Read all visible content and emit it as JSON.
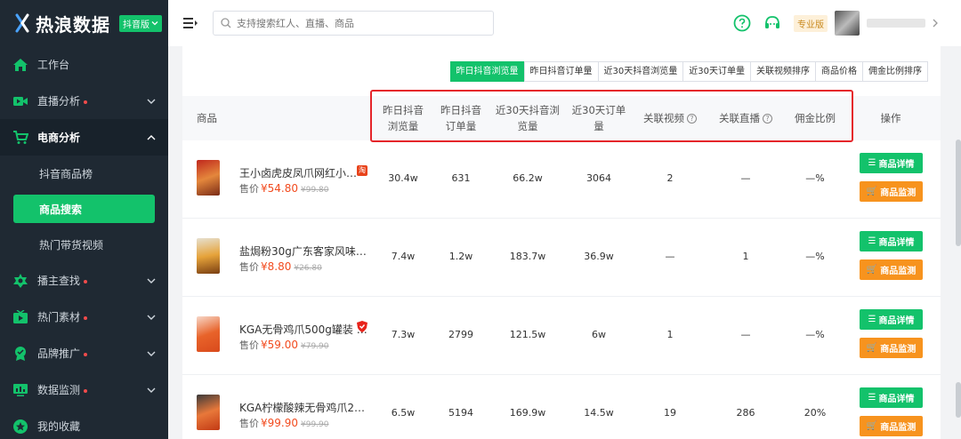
{
  "app": {
    "name": "热浪数据",
    "edition_badge": "抖音版"
  },
  "sidebar": {
    "items": [
      {
        "label": "工作台",
        "icon": "home-icon",
        "dot": false
      },
      {
        "label": "直播分析",
        "icon": "live-icon",
        "dot": true
      },
      {
        "label": "电商分析",
        "icon": "cart-icon",
        "dot": false,
        "open": true
      },
      {
        "label": "播主查找",
        "icon": "anchor-icon",
        "dot": true
      },
      {
        "label": "热门素材",
        "icon": "video-icon",
        "dot": true
      },
      {
        "label": "品牌推广",
        "icon": "brand-icon",
        "dot": true
      },
      {
        "label": "数据监测",
        "icon": "monitor-icon",
        "dot": true
      },
      {
        "label": "我的收藏",
        "icon": "favorite-icon",
        "dot": false
      }
    ],
    "submenu": [
      "抖音商品榜",
      "商品搜索",
      "热门带货视频"
    ],
    "active_sub": "商品搜索"
  },
  "topbar": {
    "search_placeholder": "支持搜索红人、直播、商品",
    "plan_badge": "专业版"
  },
  "tabs": [
    "昨日抖音浏览量",
    "昨日抖音订单量",
    "近30天抖音浏览量",
    "近30天订单量",
    "关联视频排序",
    "商品价格",
    "佣金比例排序"
  ],
  "active_tab": "昨日抖音浏览量",
  "table": {
    "headers": {
      "product": "商品",
      "yday_views_1": "昨日抖音",
      "yday_views_2": "浏览量",
      "yday_orders_1": "昨日抖音",
      "yday_orders_2": "订单量",
      "d30_views_1": "近30天抖音浏",
      "d30_views_2": "览量",
      "d30_orders_1": "近30天订单",
      "d30_orders_2": "量",
      "videos": "关联视频",
      "lives": "关联直播",
      "commission": "佣金比例",
      "actions": "操作"
    },
    "price_label": "售价",
    "detail_button": "商品详情",
    "monitor_button": "商品监测",
    "rows": [
      {
        "name": "王小卤虎皮凤爪网红小…",
        "price": "¥54.80",
        "old_price": "¥99.80",
        "yday_views": "30.4w",
        "yday_orders": "631",
        "d30_views": "66.2w",
        "d30_orders": "3064",
        "videos": "2",
        "lives": "—",
        "commission": "—%",
        "platform_icon": "taobao-icon",
        "platform_color": "#e8431b",
        "platform_text": "淘"
      },
      {
        "name": "盐焗粉30g广东客家风味…",
        "price": "¥8.80",
        "old_price": "¥26.80",
        "yday_views": "7.4w",
        "yday_orders": "1.2w",
        "d30_views": "183.7w",
        "d30_orders": "36.9w",
        "videos": "—",
        "lives": "1",
        "commission": "—%",
        "platform_icon": "",
        "platform_color": "",
        "platform_text": ""
      },
      {
        "name": "KGA无骨鸡爪500g罐装 …",
        "price": "¥59.00",
        "old_price": "¥79.90",
        "yday_views": "7.3w",
        "yday_orders": "2799",
        "d30_views": "121.5w",
        "d30_orders": "6w",
        "videos": "1",
        "lives": "—",
        "commission": "—%",
        "platform_icon": "shield-icon",
        "platform_color": "#e8231b",
        "platform_text": ""
      },
      {
        "name": "KGA柠檬酸辣无骨鸡爪2…",
        "price": "¥99.90",
        "old_price": "¥99.90",
        "yday_views": "6.5w",
        "yday_orders": "5194",
        "d30_views": "169.9w",
        "d30_orders": "14.5w",
        "videos": "19",
        "lives": "286",
        "commission": "20%",
        "platform_icon": "",
        "platform_color": "",
        "platform_text": ""
      }
    ]
  },
  "colors": {
    "sidebar_bg": "#1f2933",
    "accent_green": "#13c26b",
    "monitor_orange": "#f7931e",
    "price_red": "#f24b1f",
    "highlight_box": "#e5252a"
  }
}
